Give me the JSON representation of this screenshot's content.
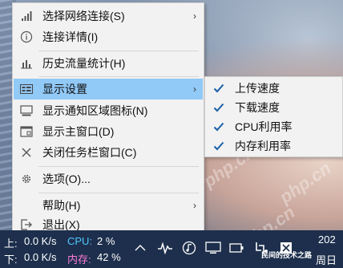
{
  "menu": {
    "items": [
      {
        "label": "选择网络连接(S)",
        "icon": "signal-bars-icon",
        "submenu": true
      },
      {
        "label": "连接详情(I)",
        "icon": "info-icon",
        "submenu": false
      },
      {
        "label": "历史流量统计(H)",
        "icon": "bar-chart-icon",
        "submenu": false
      },
      {
        "label": "显示设置",
        "icon": "display-settings-icon",
        "submenu": true
      },
      {
        "label": "显示通知区域图标(N)",
        "icon": "monitor-icon",
        "submenu": false
      },
      {
        "label": "显示主窗口(D)",
        "icon": "window-icon",
        "submenu": false
      },
      {
        "label": "关闭任务栏窗口(C)",
        "icon": "close-icon",
        "submenu": false
      },
      {
        "label": "选项(O)...",
        "icon": "gear-icon",
        "submenu": false
      },
      {
        "label": "帮助(H)",
        "icon": "",
        "submenu": true
      },
      {
        "label": "退出(X)",
        "icon": "exit-icon",
        "submenu": false
      }
    ],
    "active_item": "显示设置"
  },
  "submenu": {
    "items": [
      {
        "label": "上传速度",
        "checked": true
      },
      {
        "label": "下载速度",
        "checked": true
      },
      {
        "label": "CPU利用率",
        "checked": true
      },
      {
        "label": "内存利用率",
        "checked": true
      }
    ]
  },
  "taskbar": {
    "upload_label": "上:",
    "upload_value": "0.0 K/s",
    "cpu_label": "CPU:",
    "cpu_value": "2 %",
    "download_label": "下:",
    "download_value": "0.0 K/s",
    "memory_label": "内存:",
    "memory_value": "42 %",
    "clock_year": "202",
    "clock_day": "周日",
    "tray_icons": [
      "chevron-up-icon",
      "pulse-icon",
      "music-icon",
      "monitor-icon",
      "battery-icon",
      "input-icon",
      "notification-icon"
    ]
  },
  "watermark": {
    "text": "php.cn",
    "caption": "民间的技术之路"
  },
  "colors": {
    "menu_bg": "#f2f2f2",
    "highlight": "#91c9f7",
    "checkmark": "#1a5fa8",
    "taskbar_bg": "#1d2f4c",
    "cpu_color": "#4fc8ff",
    "memory_color": "#ff7ad9"
  }
}
